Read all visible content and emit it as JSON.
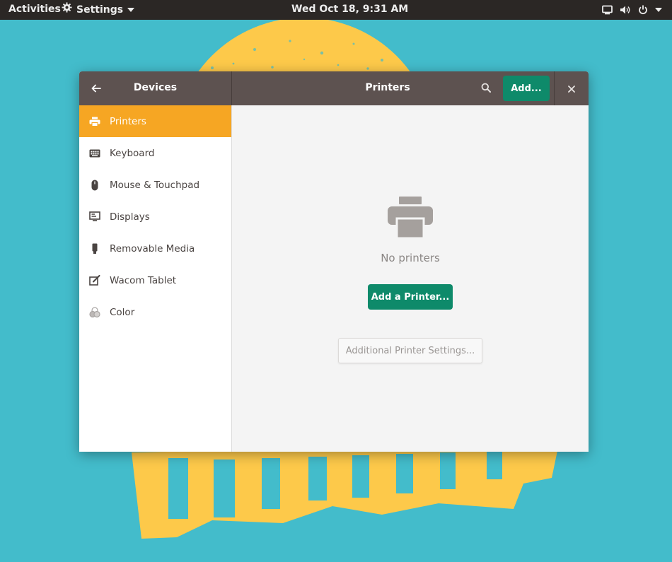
{
  "topbar": {
    "activities": "Activities",
    "app_name": "Settings",
    "clock": "Wed Oct 18,  9:31 AM",
    "icons": [
      "settings-gear-icon",
      "chevron-down-icon",
      "screen-icon",
      "volume-icon",
      "power-icon",
      "chevron-down-icon"
    ]
  },
  "window": {
    "sidebar_title": "Devices",
    "title": "Printers",
    "add_button": "Add...",
    "icons": [
      "back-arrow-icon",
      "search-icon",
      "close-icon"
    ]
  },
  "sidebar": {
    "items": [
      {
        "label": "Printers",
        "icon": "printer-icon",
        "active": true
      },
      {
        "label": "Keyboard",
        "icon": "keyboard-icon",
        "active": false
      },
      {
        "label": "Mouse & Touchpad",
        "icon": "mouse-icon",
        "active": false
      },
      {
        "label": "Displays",
        "icon": "display-icon",
        "active": false
      },
      {
        "label": "Removable Media",
        "icon": "usb-drive-icon",
        "active": false
      },
      {
        "label": "Wacom Tablet",
        "icon": "tablet-icon",
        "active": false
      },
      {
        "label": "Color",
        "icon": "color-icon",
        "active": false
      }
    ]
  },
  "main": {
    "empty_icon": "printer-icon",
    "empty_label": "No printers",
    "add_printer_button": "Add a Printer...",
    "additional_settings_button": "Additional Printer Settings..."
  },
  "colors": {
    "desktop": "#43bccb",
    "wallpaper_accent": "#fdc94a",
    "topbar": "#2b2725",
    "headerbar": "#5d5250",
    "selection": "#f6a623",
    "suggested_action": "#0e8a6a"
  }
}
